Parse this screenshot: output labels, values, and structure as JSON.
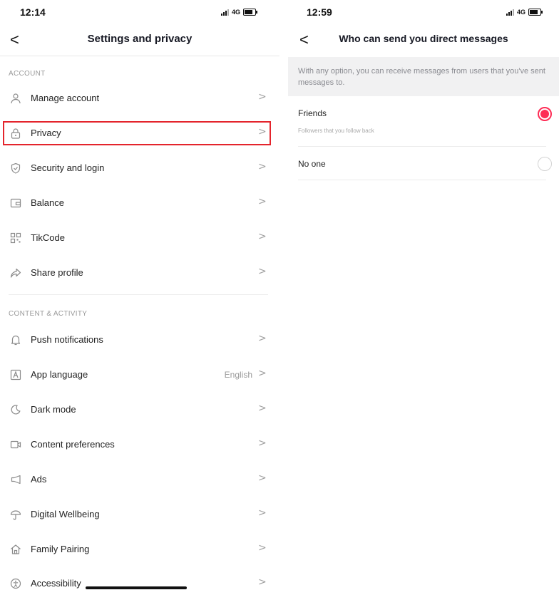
{
  "left_screen": {
    "status": {
      "time": "12:14",
      "network": "4G"
    },
    "nav": {
      "back_glyph": "<",
      "title": "Settings and privacy"
    },
    "sections": [
      {
        "header": "ACCOUNT",
        "items": [
          {
            "label": "Manage account",
            "icon": "person-icon"
          },
          {
            "label": "Privacy",
            "icon": "lock-icon"
          },
          {
            "label": "Security and login",
            "icon": "shield-icon"
          },
          {
            "label": "Balance",
            "icon": "wallet-icon"
          },
          {
            "label": "TikCode",
            "icon": "qr-code-icon"
          },
          {
            "label": "Share profile",
            "icon": "share-icon"
          }
        ]
      },
      {
        "header": "CONTENT & ACTIVITY",
        "items": [
          {
            "label": "Push notifications",
            "icon": "bell-icon"
          },
          {
            "label": "App language",
            "icon": "language-icon",
            "value": "English"
          },
          {
            "label": "Dark mode",
            "icon": "moon-icon"
          },
          {
            "label": "Content preferences",
            "icon": "video-icon"
          },
          {
            "label": "Ads",
            "icon": "megaphone-icon"
          },
          {
            "label": "Digital Wellbeing",
            "icon": "umbrella-icon"
          },
          {
            "label": "Family Pairing",
            "icon": "house-icon"
          },
          {
            "label": "Accessibility",
            "icon": "accessibility-icon"
          }
        ]
      }
    ],
    "chevron": ">",
    "highlight_color": "#e4242c"
  },
  "right_screen": {
    "status": {
      "time": "12:59",
      "network": "4G"
    },
    "nav": {
      "back_glyph": "<",
      "title": "Who can send you direct messages"
    },
    "info": "With any option, you can receive messages from users that you've sent messages to.",
    "options": [
      {
        "title": "Friends",
        "subtitle": "Followers that you follow back",
        "selected": true
      },
      {
        "title": "No one",
        "subtitle": "",
        "selected": false
      }
    ],
    "accent_color": "#fe2c55"
  }
}
